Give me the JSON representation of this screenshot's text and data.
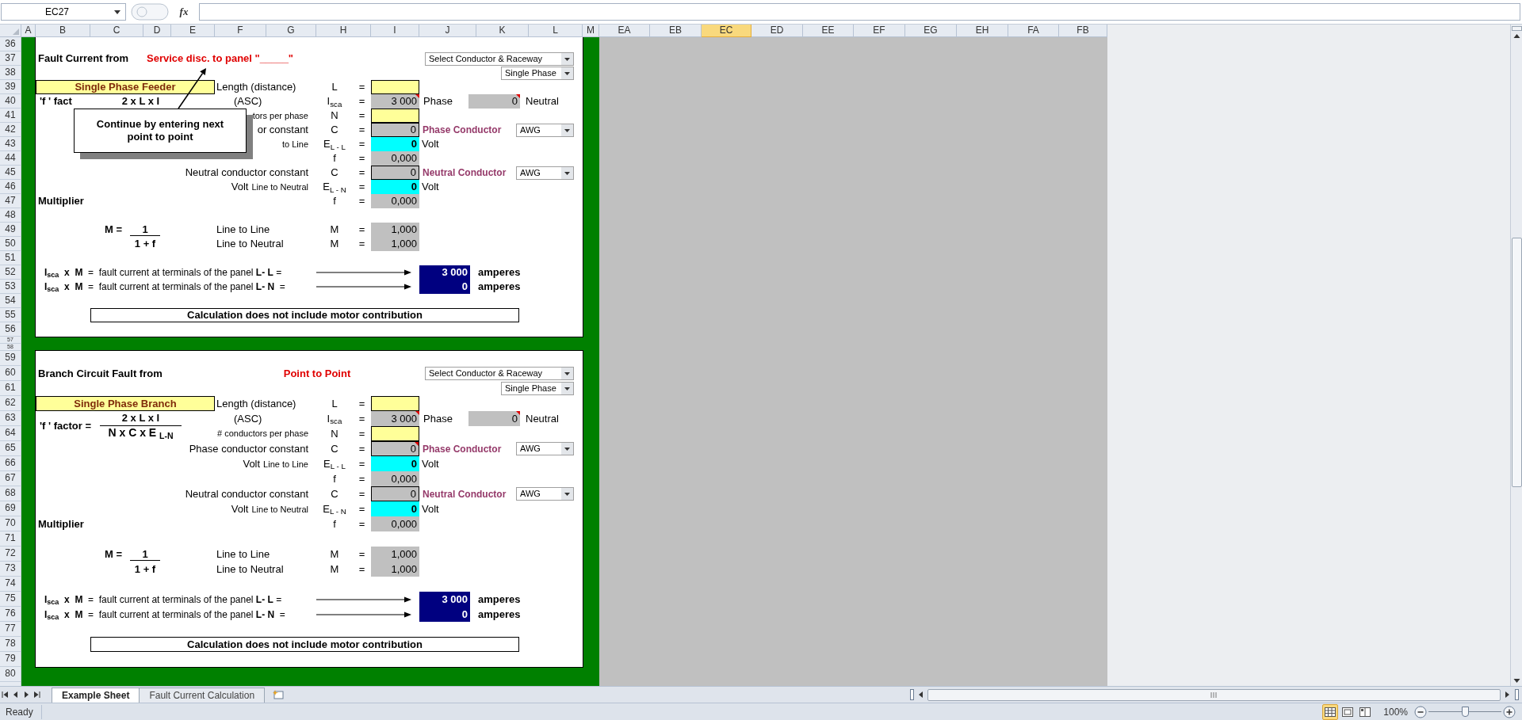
{
  "name_box": "EC27",
  "formula_button": "fx",
  "columns": [
    {
      "label": "A",
      "selected": false
    },
    {
      "label": "B",
      "selected": false
    },
    {
      "label": "C",
      "selected": false
    },
    {
      "label": "D",
      "selected": false
    },
    {
      "label": "E",
      "selected": false
    },
    {
      "label": "F",
      "selected": false
    },
    {
      "label": "G",
      "selected": false
    },
    {
      "label": "H",
      "selected": false
    },
    {
      "label": "I",
      "selected": false
    },
    {
      "label": "J",
      "selected": false
    },
    {
      "label": "K",
      "selected": false
    },
    {
      "label": "L",
      "selected": false
    },
    {
      "label": "M",
      "selected": false
    },
    {
      "label": "EA",
      "selected": false
    },
    {
      "label": "EB",
      "selected": false
    },
    {
      "label": "EC",
      "selected": true
    },
    {
      "label": "ED",
      "selected": false
    },
    {
      "label": "EE",
      "selected": false
    },
    {
      "label": "EF",
      "selected": false
    },
    {
      "label": "EG",
      "selected": false
    },
    {
      "label": "EH",
      "selected": false
    },
    {
      "label": "FA",
      "selected": false
    },
    {
      "label": "FB",
      "selected": false
    }
  ],
  "rows": [
    {
      "label": "36",
      "kind": "normal"
    },
    {
      "label": "37",
      "kind": "normal"
    },
    {
      "label": "38",
      "kind": "normal"
    },
    {
      "label": "39",
      "kind": "normal"
    },
    {
      "label": "40",
      "kind": "normal"
    },
    {
      "label": "41",
      "kind": "normal"
    },
    {
      "label": "42",
      "kind": "normal"
    },
    {
      "label": "43",
      "kind": "normal"
    },
    {
      "label": "44",
      "kind": "normal"
    },
    {
      "label": "45",
      "kind": "normal"
    },
    {
      "label": "46",
      "kind": "normal"
    },
    {
      "label": "47",
      "kind": "normal"
    },
    {
      "label": "48",
      "kind": "normal"
    },
    {
      "label": "49",
      "kind": "normal"
    },
    {
      "label": "50",
      "kind": "normal"
    },
    {
      "label": "51",
      "kind": "normal"
    },
    {
      "label": "52",
      "kind": "normal"
    },
    {
      "label": "53",
      "kind": "normal"
    },
    {
      "label": "54",
      "kind": "normal"
    },
    {
      "label": "55",
      "kind": "normal"
    },
    {
      "label": "56",
      "kind": "normal"
    },
    {
      "label": "57",
      "kind": "collapsed"
    },
    {
      "label": "58",
      "kind": "collapsed"
    },
    {
      "label": "59",
      "kind": "normal"
    },
    {
      "label": "60",
      "kind": "normal"
    },
    {
      "label": "61",
      "kind": "normal"
    },
    {
      "label": "62",
      "kind": "normal"
    },
    {
      "label": "63",
      "kind": "normal"
    },
    {
      "label": "64",
      "kind": "normal"
    },
    {
      "label": "65",
      "kind": "normal"
    },
    {
      "label": "66",
      "kind": "normal"
    },
    {
      "label": "67",
      "kind": "normal"
    },
    {
      "label": "68",
      "kind": "normal"
    },
    {
      "label": "69",
      "kind": "normal"
    },
    {
      "label": "70",
      "kind": "normal"
    },
    {
      "label": "71",
      "kind": "normal"
    },
    {
      "label": "72",
      "kind": "normal"
    },
    {
      "label": "73",
      "kind": "normal"
    },
    {
      "label": "74",
      "kind": "normal"
    },
    {
      "label": "75",
      "kind": "normal"
    },
    {
      "label": "76",
      "kind": "normal"
    },
    {
      "label": "77",
      "kind": "normal"
    },
    {
      "label": "78",
      "kind": "normal"
    },
    {
      "label": "79",
      "kind": "normal"
    },
    {
      "label": "80",
      "kind": "normal"
    }
  ],
  "sections": [
    {
      "title": "Fault Current from",
      "source": "Service disc. to panel \"_____\"",
      "raceway_select": "Select Conductor & Raceway",
      "phase_select": "Single Phase",
      "type_label": "Single Phase Feeder",
      "f_factor": {
        "label": "'f ' fact",
        "numerator": "2 x L x I"
      },
      "length": {
        "label": "Length (distance)",
        "symbol": "L",
        "equals": "=",
        "kind": "input"
      },
      "isca": {
        "label": "(ASC)",
        "symbol": "I$_{sca}$",
        "equals": "=",
        "kind": "computed",
        "value": "3 000",
        "comment": true,
        "phase_label": "Phase",
        "neutral_value": "0",
        "neutral_comment": true,
        "neutral_label": "Neutral"
      },
      "conductors": {
        "label": "tors per phase",
        "symbol": "N",
        "equals": "=",
        "kind": "input"
      },
      "phase_constant": {
        "label": "or constant",
        "symbol": "C",
        "equals": "=",
        "kind": "constant",
        "value": "0",
        "comment": false,
        "conductor_label": "Phase Conductor",
        "size_select": "AWG"
      },
      "volt_ll": {
        "sublabel": "to Line",
        "symbol": "E$_{L - L}$",
        "equals": "=",
        "kind": "voltage",
        "value": "0",
        "unit": "Volt"
      },
      "f_value": {
        "symbol": "f",
        "equals": "=",
        "kind": "computed",
        "value": "0,000"
      },
      "neutral_constant": {
        "label": "Neutral conductor constant",
        "symbol": "C",
        "equals": "=",
        "kind": "constant",
        "value": "0",
        "comment": false,
        "conductor_label": "Neutral Conductor",
        "size_select": "AWG"
      },
      "volt_ln": {
        "label": "Volt",
        "sublabel": "Line to Neutral",
        "symbol": "E$_{L - N}$",
        "equals": "=",
        "kind": "voltage",
        "value": "0",
        "unit": "Volt"
      },
      "multiplier": {
        "label": "Multiplier",
        "symbol": "f",
        "equals": "=",
        "kind": "computed",
        "value": "0,000"
      },
      "m_formula": {
        "label": "M =",
        "numerator": "1",
        "denominator": "1 + f"
      },
      "m_lines": [
        {
          "label": "Line to Line",
          "symbol": "M",
          "equals": "=",
          "kind": "computed",
          "value": "1,000"
        },
        {
          "label": "Line to Neutral",
          "symbol": "M",
          "equals": "=",
          "kind": "computed",
          "value": "1,000"
        }
      ],
      "results": [
        {
          "text": "**I**$_{sca}$  **x  M**  =  fault current at terminals of the panel **L- L** =",
          "value": "3 000",
          "unit": "amperes"
        },
        {
          "text": "**I**$_{sca}$  **x  M**  =  fault current at terminals of the panel **L- N**  =",
          "value": "0",
          "unit": "amperes"
        }
      ],
      "note": "Calculation does not include motor contribution",
      "callout": "Continue by entering next point to point"
    },
    {
      "title": "Branch Circuit Fault from",
      "source": "Point to Point",
      "raceway_select": "Select Conductor & Raceway",
      "phase_select": "Single Phase",
      "type_label": "Single Phase Branch",
      "f_factor": {
        "label": "'f ' factor =",
        "numerator": "2 x L x I",
        "denominator": "N x C x E $_{L-N}$"
      },
      "length": {
        "label": "Length (distance)",
        "symbol": "L",
        "equals": "=",
        "kind": "input"
      },
      "isca": {
        "label": "(ASC)",
        "symbol": "I$_{sca}$",
        "equals": "=",
        "kind": "computed",
        "value": "3 000",
        "comment": true,
        "phase_label": "Phase",
        "neutral_value": "0",
        "neutral_comment": true,
        "neutral_label": "Neutral"
      },
      "conductors": {
        "label": "# conductors per phase",
        "symbol": "N",
        "equals": "=",
        "kind": "input"
      },
      "phase_constant": {
        "label": "Phase conductor constant",
        "symbol": "C",
        "equals": "=",
        "kind": "constant",
        "value": "0",
        "comment": true,
        "conductor_label": "Phase Conductor",
        "size_select": "AWG"
      },
      "volt_ll": {
        "label": "Volt",
        "sublabel": "Line to Line",
        "symbol": "E$_{L - L}$",
        "equals": "=",
        "kind": "voltage",
        "value": "0",
        "unit": "Volt"
      },
      "f_value": {
        "symbol": "f",
        "equals": "=",
        "kind": "computed",
        "value": "0,000"
      },
      "neutral_constant": {
        "label": "Neutral conductor constant",
        "symbol": "C",
        "equals": "=",
        "kind": "constant",
        "value": "0",
        "comment": false,
        "conductor_label": "Neutral Conductor",
        "size_select": "AWG"
      },
      "volt_ln": {
        "label": "Volt",
        "sublabel": "Line to Neutral",
        "symbol": "E$_{L - N}$",
        "equals": "=",
        "kind": "voltage",
        "value": "0",
        "unit": "Volt"
      },
      "multiplier": {
        "label": "Multiplier",
        "symbol": "f",
        "equals": "=",
        "kind": "computed",
        "value": "0,000"
      },
      "m_formula": {
        "label": "M =",
        "numerator": "1",
        "denominator": "1 + f"
      },
      "m_lines": [
        {
          "label": "Line to Line",
          "symbol": "M",
          "equals": "=",
          "kind": "computed",
          "value": "1,000"
        },
        {
          "label": "Line to Neutral",
          "symbol": "M",
          "equals": "=",
          "kind": "computed",
          "value": "1,000"
        }
      ],
      "results": [
        {
          "text": "**I**$_{sca}$  **x  M**  =  fault current at terminals of the panel **L- L** =",
          "value": "3 000",
          "unit": "amperes"
        },
        {
          "text": "**I**$_{sca}$  **x  M**  =  fault current at terminals of the panel **L- N**  =",
          "value": "0",
          "unit": "amperes"
        }
      ],
      "note": "Calculation does not include motor contribution"
    }
  ],
  "sheet_tabs": [
    {
      "label": "Example Sheet",
      "selected": true
    },
    {
      "label": "Fault Current Calculation",
      "selected": false
    }
  ],
  "status": "Ready",
  "view_buttons": [
    {
      "kind": "normal",
      "selected": true
    },
    {
      "kind": "layout",
      "selected": false
    },
    {
      "kind": "break",
      "selected": false
    }
  ],
  "zoom": {
    "label": "100%",
    "level": 0.5
  }
}
